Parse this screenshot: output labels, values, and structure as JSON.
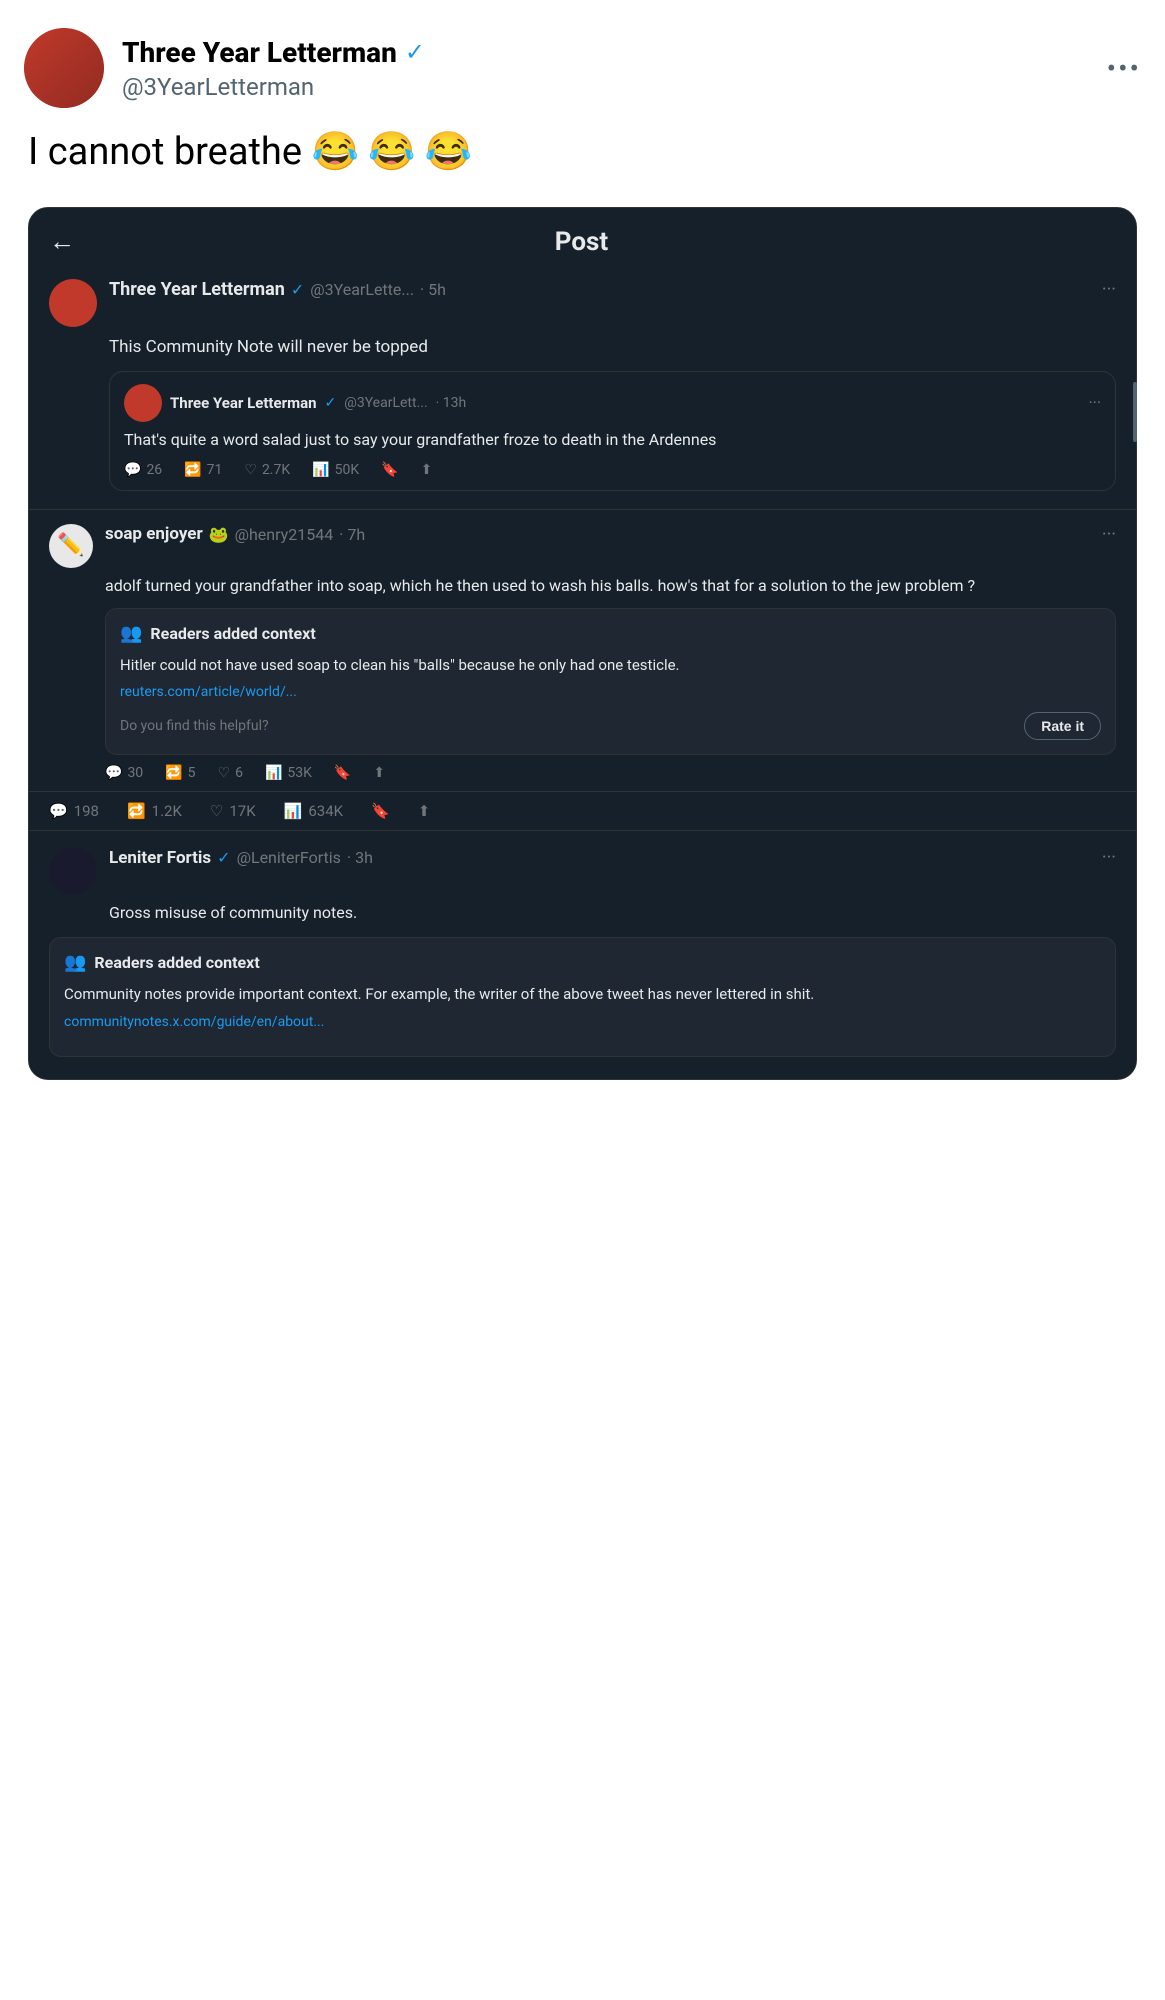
{
  "header": {
    "user_name": "Three Year Letterman",
    "verified": true,
    "handle": "@3YearLetterman",
    "more_label": "•••"
  },
  "main_tweet": {
    "text": "I cannot breathe 😂 😂 😂"
  },
  "card": {
    "title": "Post",
    "back_arrow": "←",
    "main_post": {
      "user_name": "Three Year Letterman",
      "verified": true,
      "handle": "@3YearLette...",
      "time": "· 5h",
      "dots": "···",
      "content": "This Community Note will never be topped",
      "nested": {
        "user_name": "Three Year Letterman",
        "verified": true,
        "handle": "@3YearLett...",
        "time": "· 13h",
        "dots": "···",
        "content": "That's quite a word salad just to say your grandfather froze to death in the Ardennes",
        "stats": {
          "comments": "26",
          "retweets": "71",
          "likes": "2.7K",
          "views": "50K"
        }
      }
    },
    "reply_soap": {
      "user_name": "soap enjoyer",
      "emoji": "🐸",
      "handle": "@henry21544",
      "time": "· 7h",
      "dots": "···",
      "content": "adolf turned your grandfather into soap, which he then used to wash his balls. how's that for a solution to the jew problem ?",
      "community_note": {
        "title": "Readers added context",
        "text": "Hitler could not have used soap to clean his \"balls\" because he only had one testicle.",
        "link": "reuters.com/article/world/...",
        "helpful_text": "Do you find this helpful?",
        "rate_label": "Rate it"
      },
      "stats": {
        "comments": "30",
        "retweets": "5",
        "likes": "6",
        "views": "53K"
      }
    },
    "main_stats": {
      "comments": "198",
      "retweets": "1.2K",
      "likes": "17K",
      "views": "634K"
    },
    "reply_leniter": {
      "user_name": "Leniter Fortis",
      "verified": true,
      "handle": "@LeniterFortis",
      "time": "· 3h",
      "dots": "···",
      "content": "Gross misuse of community notes.",
      "community_note": {
        "title": "Readers added context",
        "text": "Community notes provide important context. For example, the writer of the above tweet has never lettered in shit.",
        "link": "communitynotes.x.com/guide/en/about..."
      }
    }
  }
}
